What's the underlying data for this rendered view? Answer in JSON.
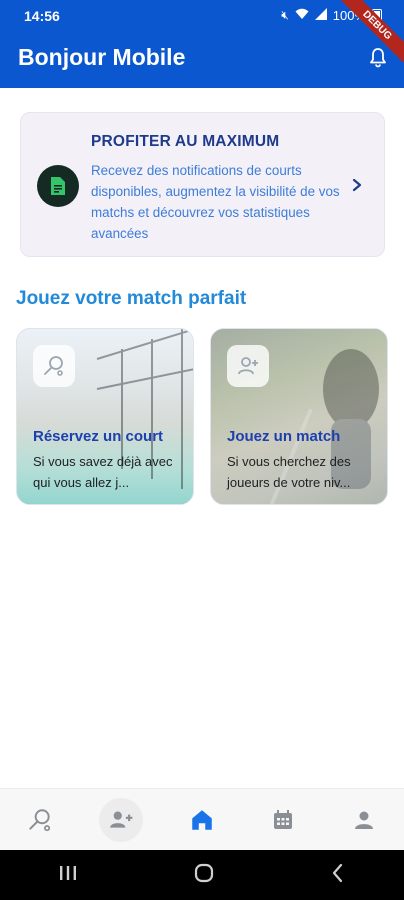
{
  "status_bar": {
    "time": "14:56",
    "battery_text": "100%"
  },
  "app_bar": {
    "title": "Bonjour Mobile",
    "debug_badge": "DEBUG",
    "accent": "#0b57d0"
  },
  "promo": {
    "title": "PROFITER AU MAXIMUM",
    "text": "Recevez des notifications de courts disponibles, augmentez la visibilité de vos matchs et découvrez vos statistiques avancées",
    "icon": "document-icon"
  },
  "section_title": "Jouez votre match parfait",
  "cards": [
    {
      "title": "Réservez un court",
      "description": "Si vous savez déjà avec qui vous allez j...",
      "icon": "search-court-icon"
    },
    {
      "title": "Jouez un match",
      "description": "Si vous cherchez des joueurs de votre niv...",
      "icon": "add-player-icon"
    }
  ],
  "bottom_nav": [
    {
      "icon": "search-court-icon",
      "active": false
    },
    {
      "icon": "group-add-icon",
      "active": false
    },
    {
      "icon": "home-icon",
      "active": true
    },
    {
      "icon": "calendar-icon",
      "active": false
    },
    {
      "icon": "profile-icon",
      "active": false
    }
  ]
}
